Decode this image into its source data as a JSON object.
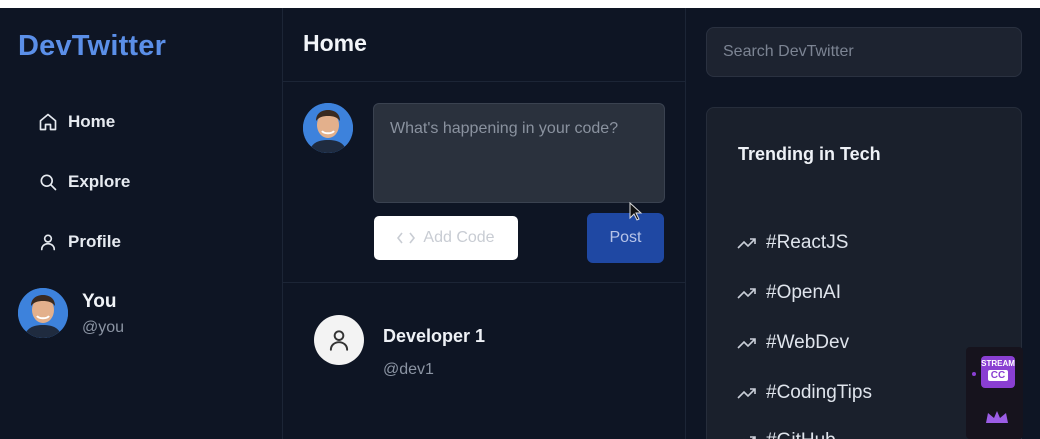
{
  "app": {
    "brand": "DevTwitter",
    "accent_color": "#5b8fe8",
    "post_button_color": "#1f48a3"
  },
  "sidebar": {
    "nav": [
      {
        "label": "Home",
        "icon": "home-icon"
      },
      {
        "label": "Explore",
        "icon": "search-icon"
      },
      {
        "label": "Profile",
        "icon": "user-icon"
      }
    ],
    "user": {
      "name": "You",
      "handle": "@you"
    }
  },
  "main": {
    "title": "Home",
    "composer": {
      "placeholder": "What's happening in your code?",
      "add_code_label": "Add Code",
      "post_label": "Post"
    },
    "posts": [
      {
        "author": "Developer 1",
        "handle": "@dev1"
      }
    ]
  },
  "right": {
    "search_placeholder": "Search DevTwitter",
    "trending_title": "Trending in Tech",
    "trends": [
      "#ReactJS",
      "#OpenAI",
      "#WebDev",
      "#CodingTips",
      "#GitHub"
    ]
  },
  "overlay": {
    "badge_line1": "STREAM",
    "badge_line2": "CC"
  }
}
